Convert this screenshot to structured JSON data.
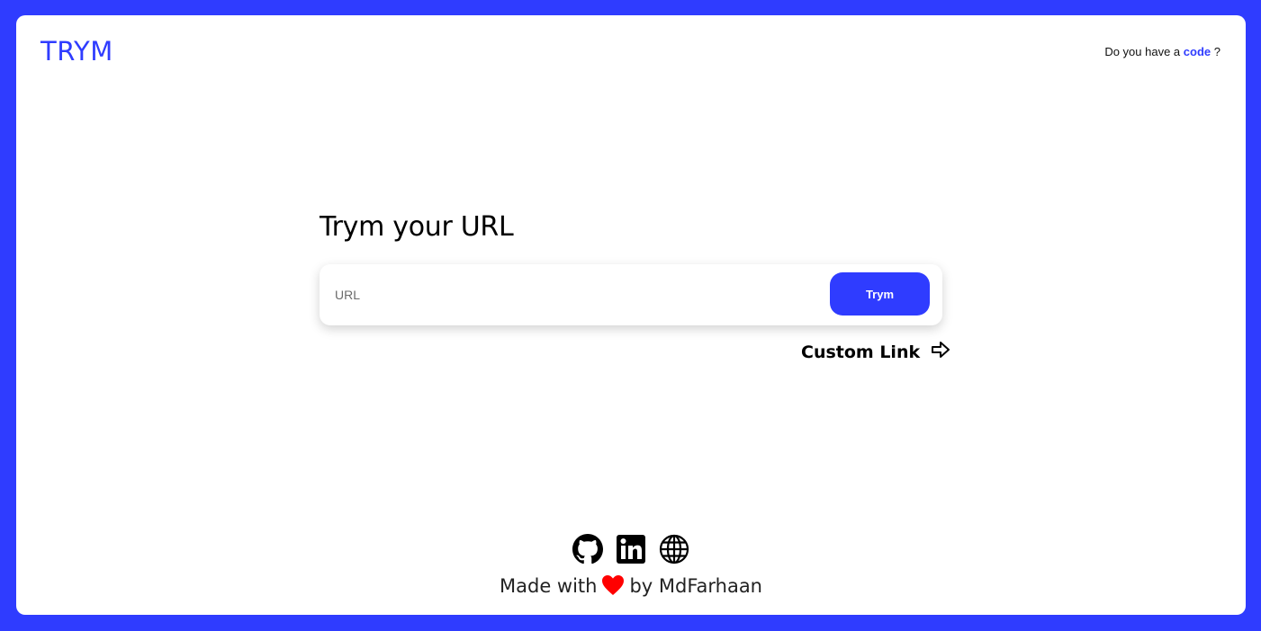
{
  "header": {
    "logo": "TRYM",
    "code_prompt_prefix": "Do you have a",
    "code_link": "code",
    "code_prompt_suffix": "?"
  },
  "main": {
    "title": "Trym your URL",
    "url_input": {
      "value": "",
      "placeholder": "URL"
    },
    "submit_label": "Trym",
    "custom_link_label": "Custom Link"
  },
  "footer": {
    "icons": [
      "github-icon",
      "linkedin-icon",
      "globe-icon"
    ],
    "made_with": "Made with",
    "by": "by MdFarhaan"
  },
  "colors": {
    "accent": "#2f3cff",
    "background": "#ffffff",
    "heart": "#ff0000"
  }
}
